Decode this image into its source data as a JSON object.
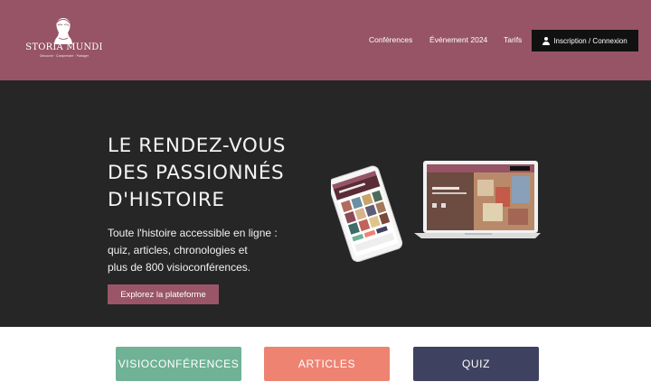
{
  "header": {
    "logo": {
      "name": "STORIA MUNDI",
      "name_left": "STORIA",
      "name_right": "MUNDI",
      "tagline": "Découvrir · Comprendre · Partager",
      "icon": "roman-bust-icon"
    },
    "nav": [
      {
        "label": "Conférences"
      },
      {
        "label": "Événement 2024"
      },
      {
        "label": "Tarifs"
      }
    ],
    "login_button": {
      "label": "Inscription / Connexion",
      "icon": "user-icon"
    },
    "colors": {
      "background": "#965466",
      "button": "#111111"
    }
  },
  "hero": {
    "title_lines": [
      "LE RENDEZ-VOUS",
      "DES PASSIONNÉS",
      "D'HISTOIRE"
    ],
    "text_lines": [
      "Toute l'histoire accessible en ligne :",
      "quiz, articles, chronologies et",
      "plus de 800 visioconférences."
    ],
    "cta_label": "Explorez la plateforme",
    "illustration": "laptop-and-tablet-illustration",
    "colors": {
      "background": "#262626",
      "cta": "#9a5568"
    }
  },
  "categories": [
    {
      "label": "VISIOCONFÉRENCES",
      "color": "#6fb296"
    },
    {
      "label": "ARTICLES",
      "color": "#ee8372"
    },
    {
      "label": "QUIZ",
      "color": "#3f4160"
    }
  ]
}
